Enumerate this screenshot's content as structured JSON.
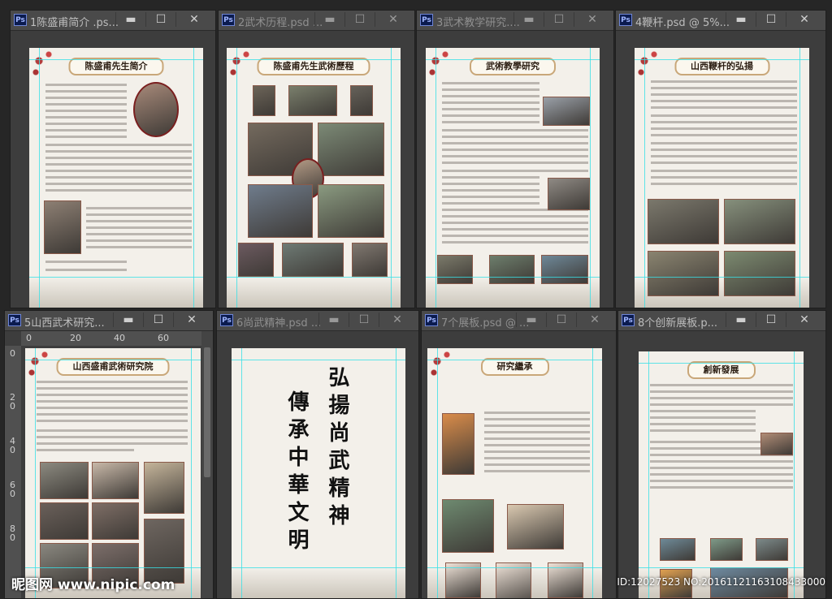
{
  "windows": [
    {
      "title": "1陈盛甫简介 .ps...",
      "heading": "陈盛甫先生简介",
      "active": true
    },
    {
      "title": "2武术历程.psd ...",
      "heading": "陈盛甫先生武術歷程",
      "active": false
    },
    {
      "title": "3武术教学研究....",
      "heading": "武術教學研究",
      "active": false
    },
    {
      "title": "4鞭杆.psd @ 5%...",
      "heading": "山西鞭杆的弘揚",
      "active": true
    },
    {
      "title": "5山西武术研究...",
      "heading": "山西盛甫武術研究院",
      "active": true
    },
    {
      "title": "6尚武精神.psd ...",
      "heading": "",
      "active": false,
      "callig_right": "弘揚尚武精神",
      "callig_left": "傳承中華文明"
    },
    {
      "title": "7个展板.psd @ ...",
      "heading": "研究繼承",
      "active": false
    },
    {
      "title": "8个创新展板.p...",
      "heading": "創新發展",
      "active": true
    }
  ],
  "window_buttons": {
    "minimize": "▬",
    "restore": "☐",
    "close": "✕"
  },
  "ps_icon_label": "Ps",
  "ruler": {
    "h_ticks": [
      "0",
      "20",
      "40",
      "60"
    ],
    "v_ticks": [
      "0",
      "2 0",
      "4 0",
      "6 0",
      "8 0"
    ]
  },
  "watermark": {
    "site": "昵图网 www.nipic.com",
    "id": "ID:12027523 NO:20161121163108433000"
  },
  "colors": {
    "background": "#262626",
    "guide": "#38e0e6",
    "banner_border": "#c9a779"
  }
}
